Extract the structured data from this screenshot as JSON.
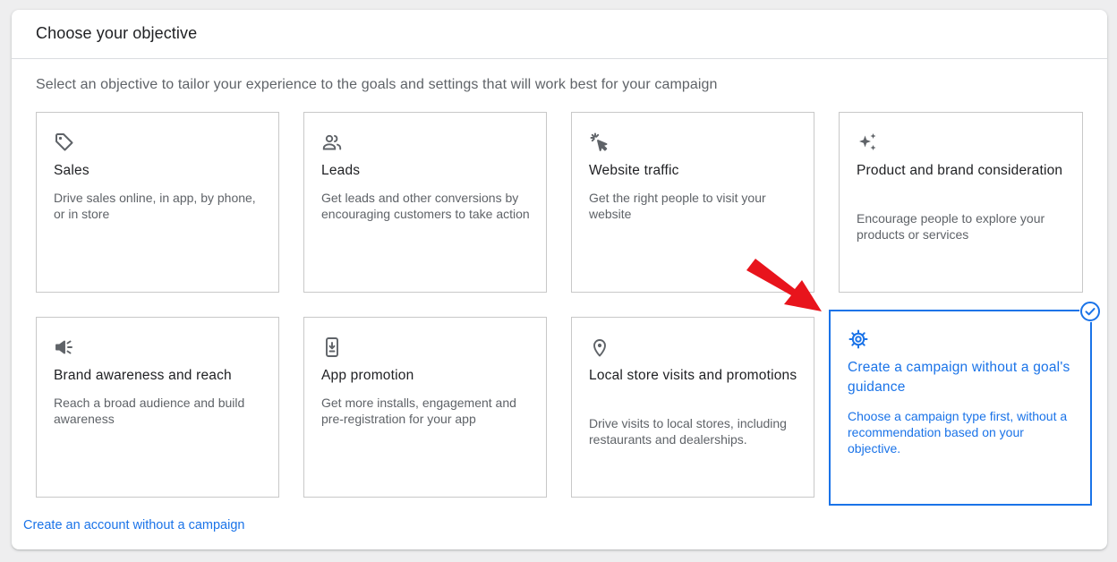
{
  "header": {
    "title": "Choose your objective"
  },
  "subtitle": "Select an objective to tailor your experience to the goals and settings that will work best for your campaign",
  "objectives": [
    {
      "title": "Sales",
      "description": "Drive sales online, in app, by phone, or in store",
      "icon": "tag-icon"
    },
    {
      "title": "Leads",
      "description": "Get leads and other conversions by encouraging customers to take action",
      "icon": "people-icon"
    },
    {
      "title": "Website traffic",
      "description": "Get the right people to visit your website",
      "icon": "cursor-click-icon"
    },
    {
      "title": "Product and brand consideration",
      "description": "Encourage people to explore your products or services",
      "icon": "sparkle-icon"
    },
    {
      "title": "Brand awareness and reach",
      "description": "Reach a broad audience and build awareness",
      "icon": "megaphone-icon"
    },
    {
      "title": "App promotion",
      "description": "Get more installs, engagement and pre-registration for your app",
      "icon": "phone-download-icon"
    },
    {
      "title": "Local store visits and promotions",
      "description": "Drive visits to local stores, including restaurants and dealerships.",
      "icon": "location-pin-icon"
    },
    {
      "title": "Create a campaign without a goal's guidance",
      "description": "Choose a campaign type first, without a recommendation based on your objective.",
      "icon": "gear-icon",
      "selected": true
    }
  ],
  "footer": {
    "link": "Create an account without a campaign"
  },
  "colors": {
    "accent": "#1a73e8",
    "annotation_arrow": "#e8141c",
    "card_border": "#c8c8c8",
    "text_primary": "#202124",
    "text_secondary": "#5f6368"
  }
}
